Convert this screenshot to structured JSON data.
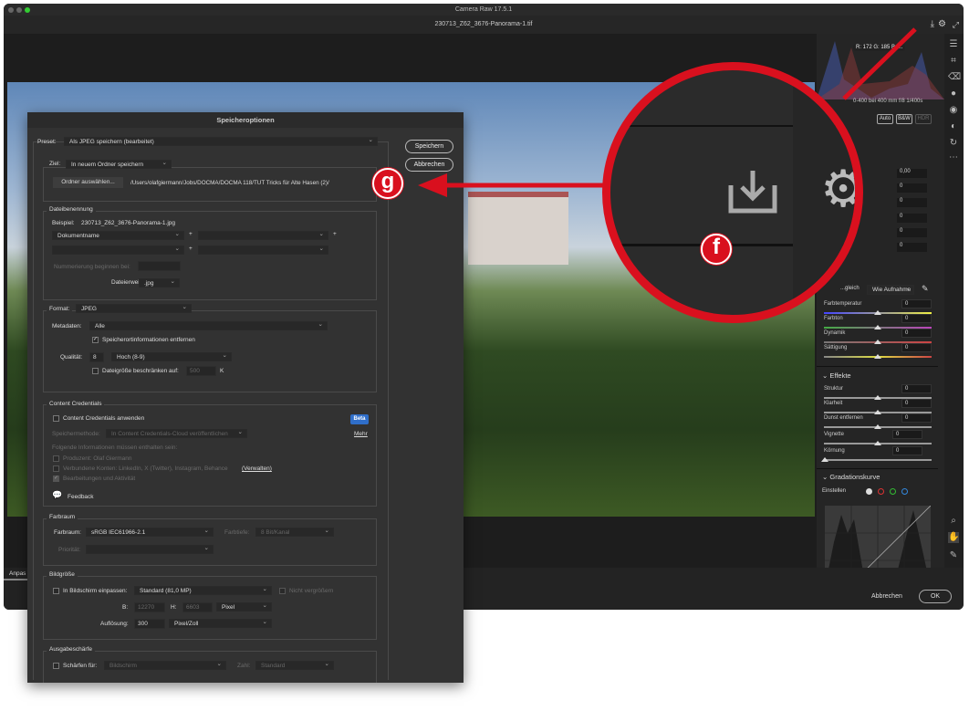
{
  "app": {
    "title": "Camera Raw 17.5.1",
    "filename": "230713_Z62_3676-Panorama-1.tif"
  },
  "histogram": {
    "readout": "R: 172   G: 185   B: ...",
    "exif": "0-400 bei 400 mm   f/8   1/400s"
  },
  "panel": {
    "profile_buttons": [
      "Auto",
      "B&W",
      "HDR"
    ],
    "basic_values": [
      "0,00",
      "0",
      "0",
      "0",
      "0",
      "0"
    ],
    "wb_label": "...gleich",
    "wb_value": "Wie Aufnahme",
    "color_sliders": [
      {
        "label": "Farbtemperatur",
        "value": "0"
      },
      {
        "label": "Farbton",
        "value": "0"
      },
      {
        "label": "Dynamik",
        "value": "0"
      },
      {
        "label": "Sättigung",
        "value": "0"
      }
    ],
    "effects_title": "Effekte",
    "effects": [
      {
        "label": "Struktur",
        "value": "0"
      },
      {
        "label": "Klarheit",
        "value": "0"
      },
      {
        "label": "Dunst entfernen",
        "value": "0"
      },
      {
        "label": "Vignette",
        "value": "0"
      },
      {
        "label": "Körnung",
        "value": "0"
      }
    ],
    "curve_title": "Gradationskurve",
    "curve_adjust": "Einstellen"
  },
  "bottom": {
    "tab_label": "Anpas",
    "cancel": "Abbrechen",
    "ok": "OK"
  },
  "dialog": {
    "title": "Speicheroptionen",
    "preset_label": "Preset:",
    "preset_value": "Als JPEG speichern (bearbeitet)",
    "save": "Speichern",
    "cancel": "Abbrechen",
    "dest_label": "Ziel:",
    "dest_value": "In neuem Ordner speichern",
    "choose_folder": "Ordner auswählen...",
    "folder_path": "/Users/olafgiermann/Jobs/DOCMA/DOCMA 118/TUT Tricks für Alte Hasen (2)/",
    "naming_title": "Dateibenennung",
    "example_label": "Beispiel:",
    "example_value": "230713_Z62_3676-Panorama-1.jpg",
    "name_field1": "Dokumentname",
    "plus": "+",
    "numbering_label": "Nummerierung beginnen bei:",
    "ext_label": "Dateierweiterung:",
    "ext_value": ".jpg",
    "format_label": "Format:",
    "format_value": "JPEG",
    "meta_label": "Metadaten:",
    "meta_value": "Alle",
    "remove_location": "Speicherortinformationen entfernen",
    "quality_label": "Qualität:",
    "quality_value": "8",
    "quality_preset": "Hoch  (8-9)",
    "limit_label": "Dateigröße beschränken auf:",
    "limit_value": "500",
    "limit_unit": "K",
    "cc_title": "Content Credentials",
    "cc_apply": "Content Credentials anwenden",
    "beta": "Beta",
    "cc_method_label": "Speichermethode:",
    "cc_method_value": "In Content Credentials-Cloud veröffentlichen",
    "more": "Mehr",
    "cc_info": "Folgende Informationen müssen enthalten sein:",
    "cc_producer": "Produzent: Olaf Giermann",
    "cc_accounts": "Verbundene Konten: LinkedIn, X (Twitter), Instagram, Behance",
    "manage": "(Verwalten)",
    "cc_edits": "Bearbeitungen und Aktivität",
    "feedback": "Feedback",
    "cs_title": "Farbraum",
    "cs_label": "Farbraum:",
    "cs_value": "sRGB IEC61966-2.1",
    "depth_label": "Farbtiefe:",
    "depth_value": "8 Bit/Kanal",
    "priority_label": "Priorität:",
    "size_title": "Bildgröße",
    "fit_label": "In Bildschirm einpassen:",
    "fit_value": "Standard  (81,0 MP)",
    "no_enlarge": "Nicht vergrößern",
    "w_label": "B:",
    "w_value": "12270",
    "h_label": "H:",
    "h_value": "6603",
    "unit_value": "Pixel",
    "res_label": "Auflösung:",
    "res_value": "300",
    "res_unit": "Pixel/Zoll",
    "sharp_title": "Ausgabeschärfe",
    "sharp_label": "Schärfen für:",
    "sharp_value": "Bildschirm",
    "amount_label": "Zahl:",
    "amount_value": "Standard"
  },
  "annotations": {
    "f": "f",
    "g": "g",
    "accent": "#d9101e"
  }
}
